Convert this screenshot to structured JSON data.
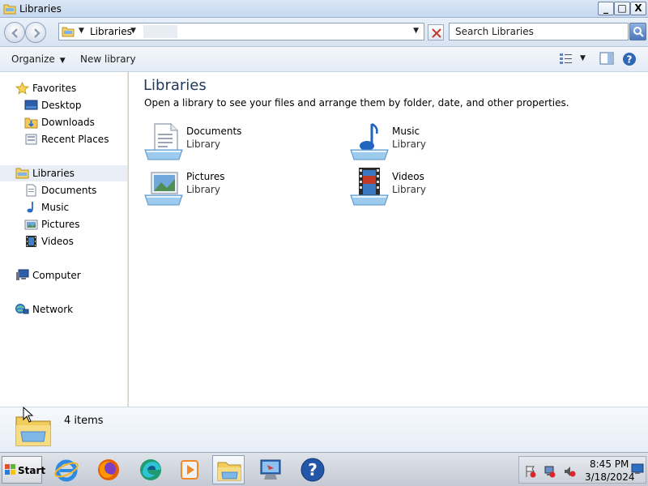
{
  "window": {
    "title": "Libraries",
    "min_label": "_",
    "max_label": "□",
    "close_label": "X"
  },
  "address": {
    "breadcrumb": "Libraries",
    "search_placeholder": "Search Libraries"
  },
  "commandbar": {
    "organize_label": "Organize",
    "new_library_label": "New library"
  },
  "navpane": {
    "favorites": "Favorites",
    "favorites_items": [
      "Desktop",
      "Downloads",
      "Recent Places"
    ],
    "libraries": "Libraries",
    "libraries_items": [
      "Documents",
      "Music",
      "Pictures",
      "Videos"
    ],
    "computer": "Computer",
    "network": "Network"
  },
  "main": {
    "heading": "Libraries",
    "subheading": "Open a library to see your files and arrange them by folder, date, and other properties.",
    "libraries": [
      {
        "name": "Documents",
        "type": "Library",
        "icon": "documents-library-icon"
      },
      {
        "name": "Music",
        "type": "Library",
        "icon": "music-library-icon"
      },
      {
        "name": "Pictures",
        "type": "Library",
        "icon": "pictures-library-icon"
      },
      {
        "name": "Videos",
        "type": "Library",
        "icon": "videos-library-icon"
      }
    ]
  },
  "details": {
    "count_text": "4 items"
  },
  "taskbar": {
    "start_label": "Start",
    "apps": [
      "internet-explorer-icon",
      "firefox-icon",
      "edge-icon",
      "media-player-icon",
      "libraries-explorer-icon",
      "remote-desktop-icon",
      "help-icon"
    ],
    "clock_time": "8:45 PM",
    "clock_date": "3/18/2024"
  },
  "colors": {
    "heading": "#1e395b",
    "selection": "#e9eef6",
    "accent": "#4b78bb"
  }
}
